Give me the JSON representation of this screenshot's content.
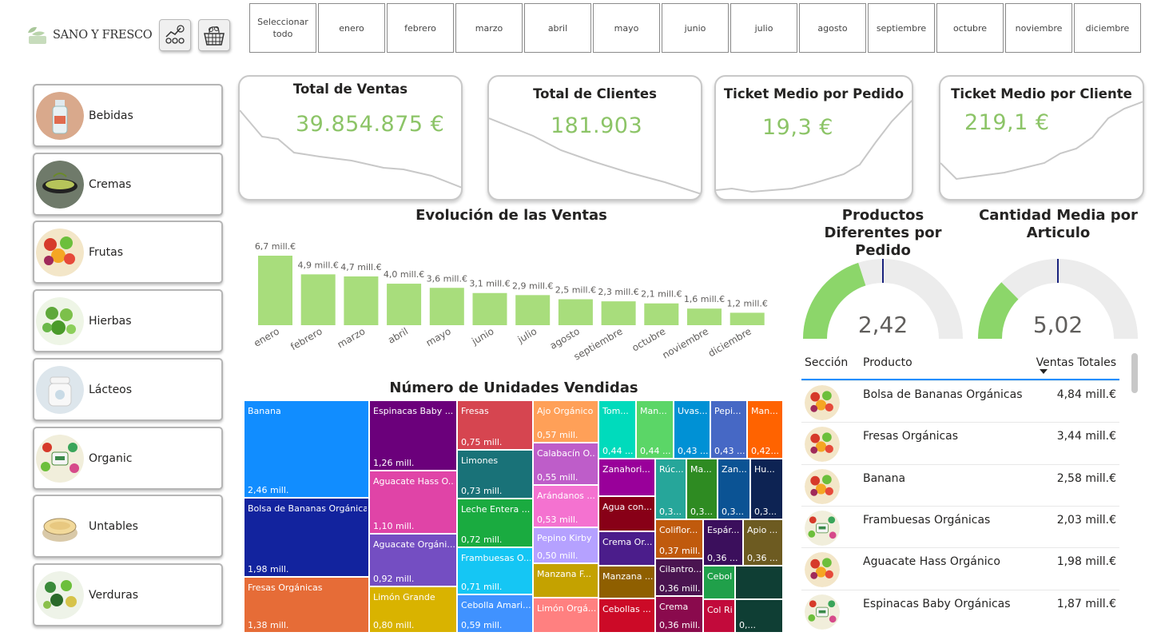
{
  "brand": {
    "name": "SANO Y FRESCO",
    "accent": "#8cc467"
  },
  "nav_icons": [
    "analytics-dashboard-icon",
    "shopping-basket-icon"
  ],
  "months": {
    "select_all": "Seleccionar todo",
    "items": [
      "enero",
      "febrero",
      "marzo",
      "abril",
      "mayo",
      "junio",
      "julio",
      "agosto",
      "septiembre",
      "octubre",
      "noviembre",
      "diciembre"
    ]
  },
  "categories": [
    {
      "label": "Bebidas",
      "icon": "bottle-icon"
    },
    {
      "label": "Cremas",
      "icon": "soup-bowl-icon"
    },
    {
      "label": "Frutas",
      "icon": "fruits-icon"
    },
    {
      "label": "Hierbas",
      "icon": "herbs-icon"
    },
    {
      "label": "Lácteos",
      "icon": "milk-jar-icon"
    },
    {
      "label": "Organic",
      "icon": "organic-icon"
    },
    {
      "label": "Untables",
      "icon": "spread-tub-icon"
    },
    {
      "label": "Verduras",
      "icon": "vegetables-icon"
    }
  ],
  "kpis": [
    {
      "title": "Total de Ventas",
      "value": "39.854.875 €"
    },
    {
      "title": "Total de Clientes",
      "value": "181.903"
    },
    {
      "title": "Ticket Medio por Pedido",
      "value": "19,3 €"
    },
    {
      "title": "Ticket Medio por Cliente",
      "value": "219,1 €"
    }
  ],
  "chart_data": [
    {
      "type": "bar",
      "title": "Evolución de las Ventas",
      "categories": [
        "enero",
        "febrero",
        "marzo",
        "abril",
        "mayo",
        "junio",
        "julio",
        "agosto",
        "septiembre",
        "octubre",
        "noviembre",
        "diciembre"
      ],
      "values": [
        6.7,
        4.9,
        4.7,
        4.0,
        3.6,
        3.1,
        2.9,
        2.5,
        2.3,
        2.1,
        1.6,
        1.2
      ],
      "labels": [
        "6,7 mill.€",
        "4,9 mill.€",
        "4,7 mill.€",
        "4,0 mill.€",
        "3,6 mill.€",
        "3,1 mill.€",
        "2,9 mill.€",
        "2,5 mill.€",
        "2,3 mill.€",
        "2,1 mill.€",
        "1,6 mill.€",
        "1,2 mill.€"
      ],
      "color": "#a8dd7c"
    },
    {
      "type": "heatmap",
      "title": "Número de Unidades Vendidas",
      "items": [
        {
          "name": "Banana",
          "value": "2,46 mill.",
          "color": "#118dff"
        },
        {
          "name": "Bolsa de Bananas Orgánicas",
          "value": "1,98 mill.",
          "color": "#12239e"
        },
        {
          "name": "Fresas Orgánicas",
          "value": "1,38 mill.",
          "color": "#e66c37"
        },
        {
          "name": "Espinacas Baby ...",
          "value": "1,26 mill.",
          "color": "#6b007b"
        },
        {
          "name": "Aguacate Hass O...",
          "value": "1,10 mill.",
          "color": "#e044a7"
        },
        {
          "name": "Aguacate Orgáni...",
          "value": "0,92 mill.",
          "color": "#744ec2"
        },
        {
          "name": "Limón Grande",
          "value": "0,80 mill.",
          "color": "#d9b300"
        },
        {
          "name": "Fresas",
          "value": "0,75 mill.",
          "color": "#d64550"
        },
        {
          "name": "Limones",
          "value": "0,73 mill.",
          "color": "#197278"
        },
        {
          "name": "Leche Entera ...",
          "value": "0,72 mill.",
          "color": "#1aab40"
        },
        {
          "name": "Frambuesas O...",
          "value": "0,71 mill.",
          "color": "#15c6f4"
        },
        {
          "name": "Cebolla Amari...",
          "value": "0,59 mill.",
          "color": "#4092ff"
        },
        {
          "name": "Ajo Orgánico",
          "value": "0,57 mill.",
          "color": "#ffa058"
        },
        {
          "name": "Calabacín O...",
          "value": "0,55 mill.",
          "color": "#be5dc9"
        },
        {
          "name": "Arándanos ...",
          "value": "0,53 mill.",
          "color": "#f472d0"
        },
        {
          "name": "Pepino Kirby",
          "value": "0,50 mill.",
          "color": "#b5a1ff"
        },
        {
          "name": "Manzana F...",
          "value": "",
          "color": "#c4a200"
        },
        {
          "name": "Limón Orgá...",
          "value": "",
          "color": "#ff8080"
        },
        {
          "name": "Tom...",
          "value": "0,44 ...",
          "color": "#00dbbc"
        },
        {
          "name": "Man...",
          "value": "0,44 ...",
          "color": "#5bd667"
        },
        {
          "name": "Uvas...",
          "value": "0,43 ...",
          "color": "#0091d5"
        },
        {
          "name": "Pepi...",
          "value": "0,43 ...",
          "color": "#4668c5"
        },
        {
          "name": "Man...",
          "value": "0,42...",
          "color": "#ff6300"
        },
        {
          "name": "Zanahori...",
          "value": "",
          "color": "#99009a"
        },
        {
          "name": "Agua con...",
          "value": "",
          "color": "#880017"
        },
        {
          "name": "Crema Or...",
          "value": "",
          "color": "#4b1d8b"
        },
        {
          "name": "Manzana ...",
          "value": "",
          "color": "#8f5f00"
        },
        {
          "name": "Cebollas ...",
          "value": "",
          "color": "#cc0a27"
        },
        {
          "name": "Rúc...",
          "value": "0,3...",
          "color": "#26a69a"
        },
        {
          "name": "Ma...",
          "value": "0,3...",
          "color": "#2e8b22"
        },
        {
          "name": "Zan...",
          "value": "0,3...",
          "color": "#0b5394"
        },
        {
          "name": "Hu...",
          "value": "0,3...",
          "color": "#0d2353"
        },
        {
          "name": "Coliflor...",
          "value": "0,37 mill.",
          "color": "#c05a0d"
        },
        {
          "name": "Espár...",
          "value": "0,36 ...",
          "color": "#3b0f5c"
        },
        {
          "name": "Apio ...",
          "value": "0,36 ...",
          "color": "#6d5b21"
        },
        {
          "name": "Cilantro...",
          "value": "0,36 mill.",
          "color": "#4a1450"
        },
        {
          "name": "Cebolla ...",
          "value": "",
          "color": "#20a04a"
        },
        {
          "name": "",
          "value": "",
          "color": "#0f3e34"
        },
        {
          "name": "Crema",
          "value": "0,36 mill.",
          "color": "#8a0a4d"
        },
        {
          "name": "Col Riza...",
          "value": "",
          "color": "#c20a3b"
        },
        {
          "name": "",
          "value": "0,...",
          "color": "#0f3e34"
        }
      ]
    }
  ],
  "gauges": [
    {
      "title": "Productos Diferentes por Pedido",
      "value": "2,42",
      "fill": 0.4,
      "target": 0.5,
      "color": "#8cd66a"
    },
    {
      "title": "Cantidad Media por Articulo",
      "value": "5,02",
      "fill": 0.25,
      "target": 0.5,
      "color": "#8cd66a"
    }
  ],
  "table": {
    "headers": {
      "section": "Sección",
      "product": "Producto",
      "sales": "Ventas Totales"
    },
    "rows": [
      {
        "product": "Bolsa de Bananas Orgánicas",
        "sales": "4,84 mill.€",
        "icon": "fruits-icon"
      },
      {
        "product": "Fresas Orgánicas",
        "sales": "3,44 mill.€",
        "icon": "fruits-icon"
      },
      {
        "product": "Banana",
        "sales": "2,58 mill.€",
        "icon": "fruits-icon"
      },
      {
        "product": "Frambuesas Orgánicas",
        "sales": "2,03 mill.€",
        "icon": "organic-icon"
      },
      {
        "product": "Aguacate Hass Orgánico",
        "sales": "1,98 mill.€",
        "icon": "fruits-icon"
      },
      {
        "product": "Espinacas Baby Orgánicas",
        "sales": "1,87 mill.€",
        "icon": "organic-icon"
      }
    ]
  }
}
